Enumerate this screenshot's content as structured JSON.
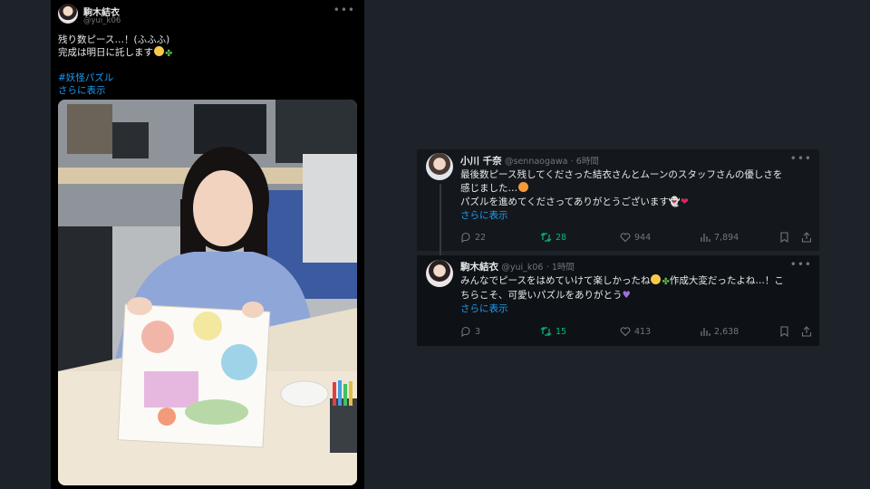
{
  "main_tweet": {
    "author_name": "駒木結衣",
    "handle": "@yui_k06",
    "lines": [
      "残り数ピース…！(ふふふ)",
      "完成は明日に託します"
    ],
    "hashtag": "#妖怪パズル",
    "show_more": "さらに表示"
  },
  "replies": [
    {
      "author_name": "小川 千奈",
      "handle": "@sennaogawa",
      "time": "· 6時間",
      "lines": [
        "最後数ピース残してくださった結衣さんとムーンのスタッフさんの優しさを",
        "感じました…",
        "パズルを進めてくださってありがとうございます"
      ],
      "show_more": "さらに表示",
      "stats": {
        "replies": "22",
        "retweets": "28",
        "likes": "944",
        "views": "7,894"
      }
    },
    {
      "author_name": "駒木結衣",
      "handle": "@yui_k06",
      "time": "· 1時間",
      "lines": [
        "みんなでピースをはめていけて楽しかったね",
        "作成大変だったよね…！こ",
        "ちらこそ、可愛いパズルをありがとう"
      ],
      "show_more": "さらに表示",
      "stats": {
        "replies": "3",
        "retweets": "15",
        "likes": "413",
        "views": "2,638"
      }
    }
  ],
  "icons": [
    "more-icon",
    "reply-icon",
    "retweet-icon",
    "like-icon",
    "views-icon",
    "bookmark-icon",
    "share-icon"
  ],
  "colors": {
    "background": "#1d2329",
    "link": "#1d9bf0",
    "retweet": "#00ba7c",
    "muted": "#71767b"
  }
}
